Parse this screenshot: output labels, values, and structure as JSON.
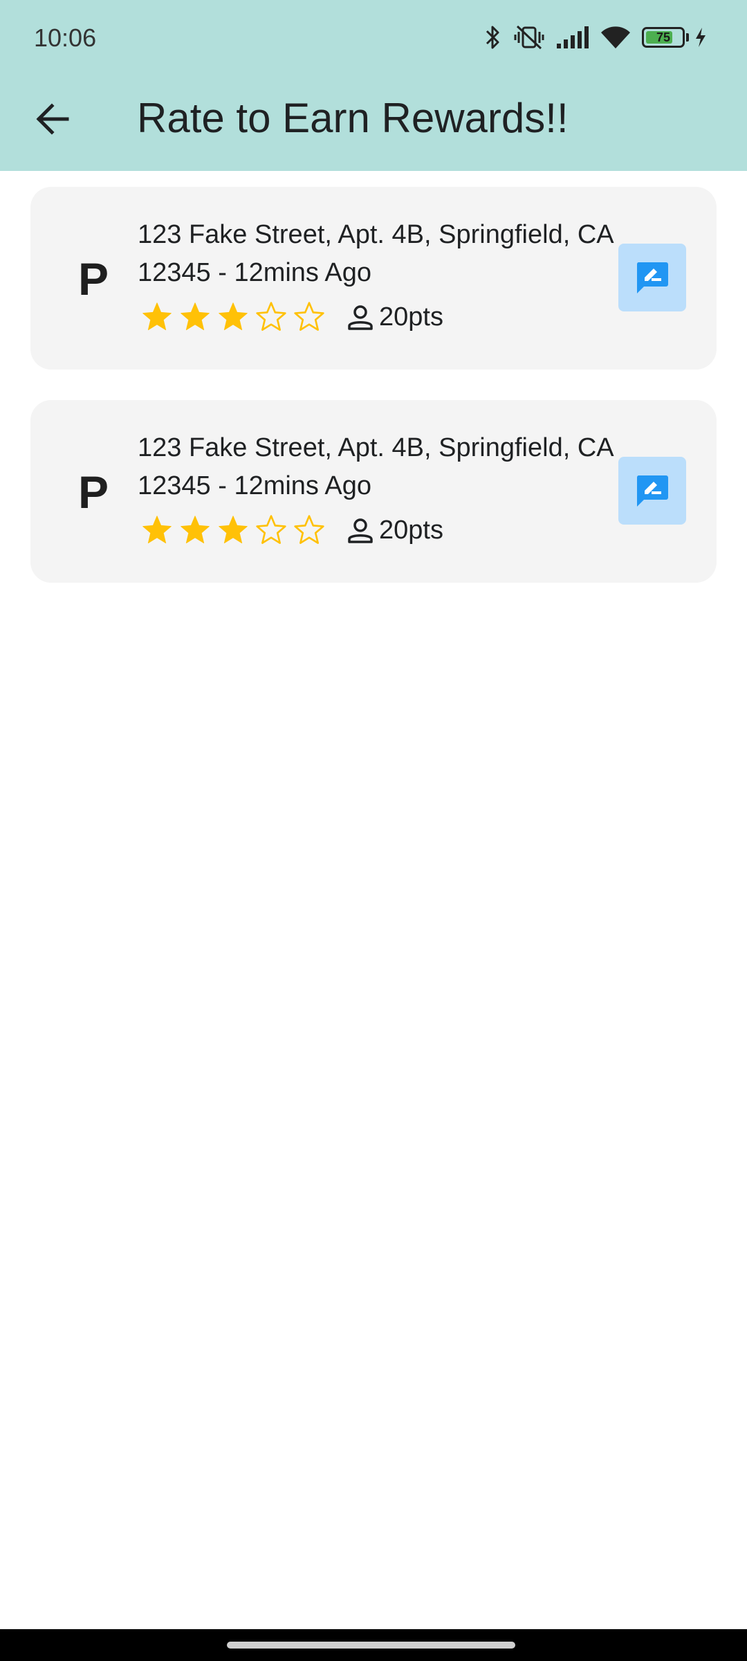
{
  "status_bar": {
    "time": "10:06",
    "battery_level": "75",
    "battery_fraction": 0.75,
    "icons": [
      "bluetooth-icon",
      "vibrate-off-icon",
      "signal-icon",
      "wifi-icon",
      "battery-icon",
      "charging-icon"
    ]
  },
  "app_bar": {
    "back_icon": "arrow-back-icon",
    "title": "Rate to Earn Rewards!!"
  },
  "colors": {
    "app_bar": "#b2dfdb",
    "card": "#f4f4f4",
    "star": "#ffc107",
    "review_button_bg": "#bbdefb",
    "review_icon": "#2196f3"
  },
  "items": [
    {
      "brand_letter": "P",
      "address": "123 Fake Street, Apt. 4B, Springfield, CA 12345 - 12mins Ago",
      "rating": 3,
      "max_rating": 5,
      "points": "20pts",
      "points_icon": "person-icon",
      "action_icon": "rate-review-icon"
    },
    {
      "brand_letter": "P",
      "address": "123 Fake Street, Apt. 4B, Springfield, CA 12345 - 12mins Ago",
      "rating": 3,
      "max_rating": 5,
      "points": "20pts",
      "points_icon": "person-icon",
      "action_icon": "rate-review-icon"
    }
  ]
}
